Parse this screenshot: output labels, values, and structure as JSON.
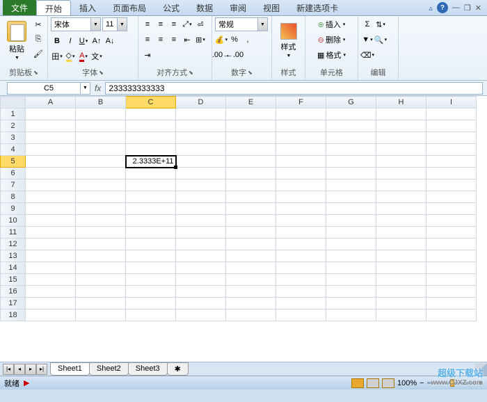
{
  "titlebar": {
    "file": "文件",
    "tabs": [
      "开始",
      "插入",
      "页面布局",
      "公式",
      "数据",
      "审阅",
      "视图",
      "新建选项卡"
    ],
    "help": "?"
  },
  "ribbon": {
    "clipboard": {
      "paste": "粘贴",
      "label": "剪贴板"
    },
    "font": {
      "name": "宋体",
      "size": "11",
      "label": "字体"
    },
    "align": {
      "label": "对齐方式"
    },
    "number": {
      "fmt": "常规",
      "label": "数字",
      "percent": "%"
    },
    "styles": {
      "label": "样式",
      "btn": "样式"
    },
    "cells": {
      "insert": "插入",
      "delete": "删除",
      "format": "格式",
      "label": "单元格"
    },
    "edit": {
      "label": "编辑",
      "sigma": "Σ"
    }
  },
  "namebox": "C5",
  "formula": "233333333333",
  "grid": {
    "cols": [
      "A",
      "B",
      "C",
      "D",
      "E",
      "F",
      "G",
      "H",
      "I"
    ],
    "rows": 18,
    "selected": {
      "row": 5,
      "col": "C",
      "display": "2.3333E+11"
    }
  },
  "sheets": [
    "Sheet1",
    "Sheet2",
    "Sheet3"
  ],
  "status": {
    "ready": "就绪",
    "zoom": "100%"
  },
  "watermark": {
    "line1": "超级下载站",
    "line2": "www.CJXZ.com"
  }
}
